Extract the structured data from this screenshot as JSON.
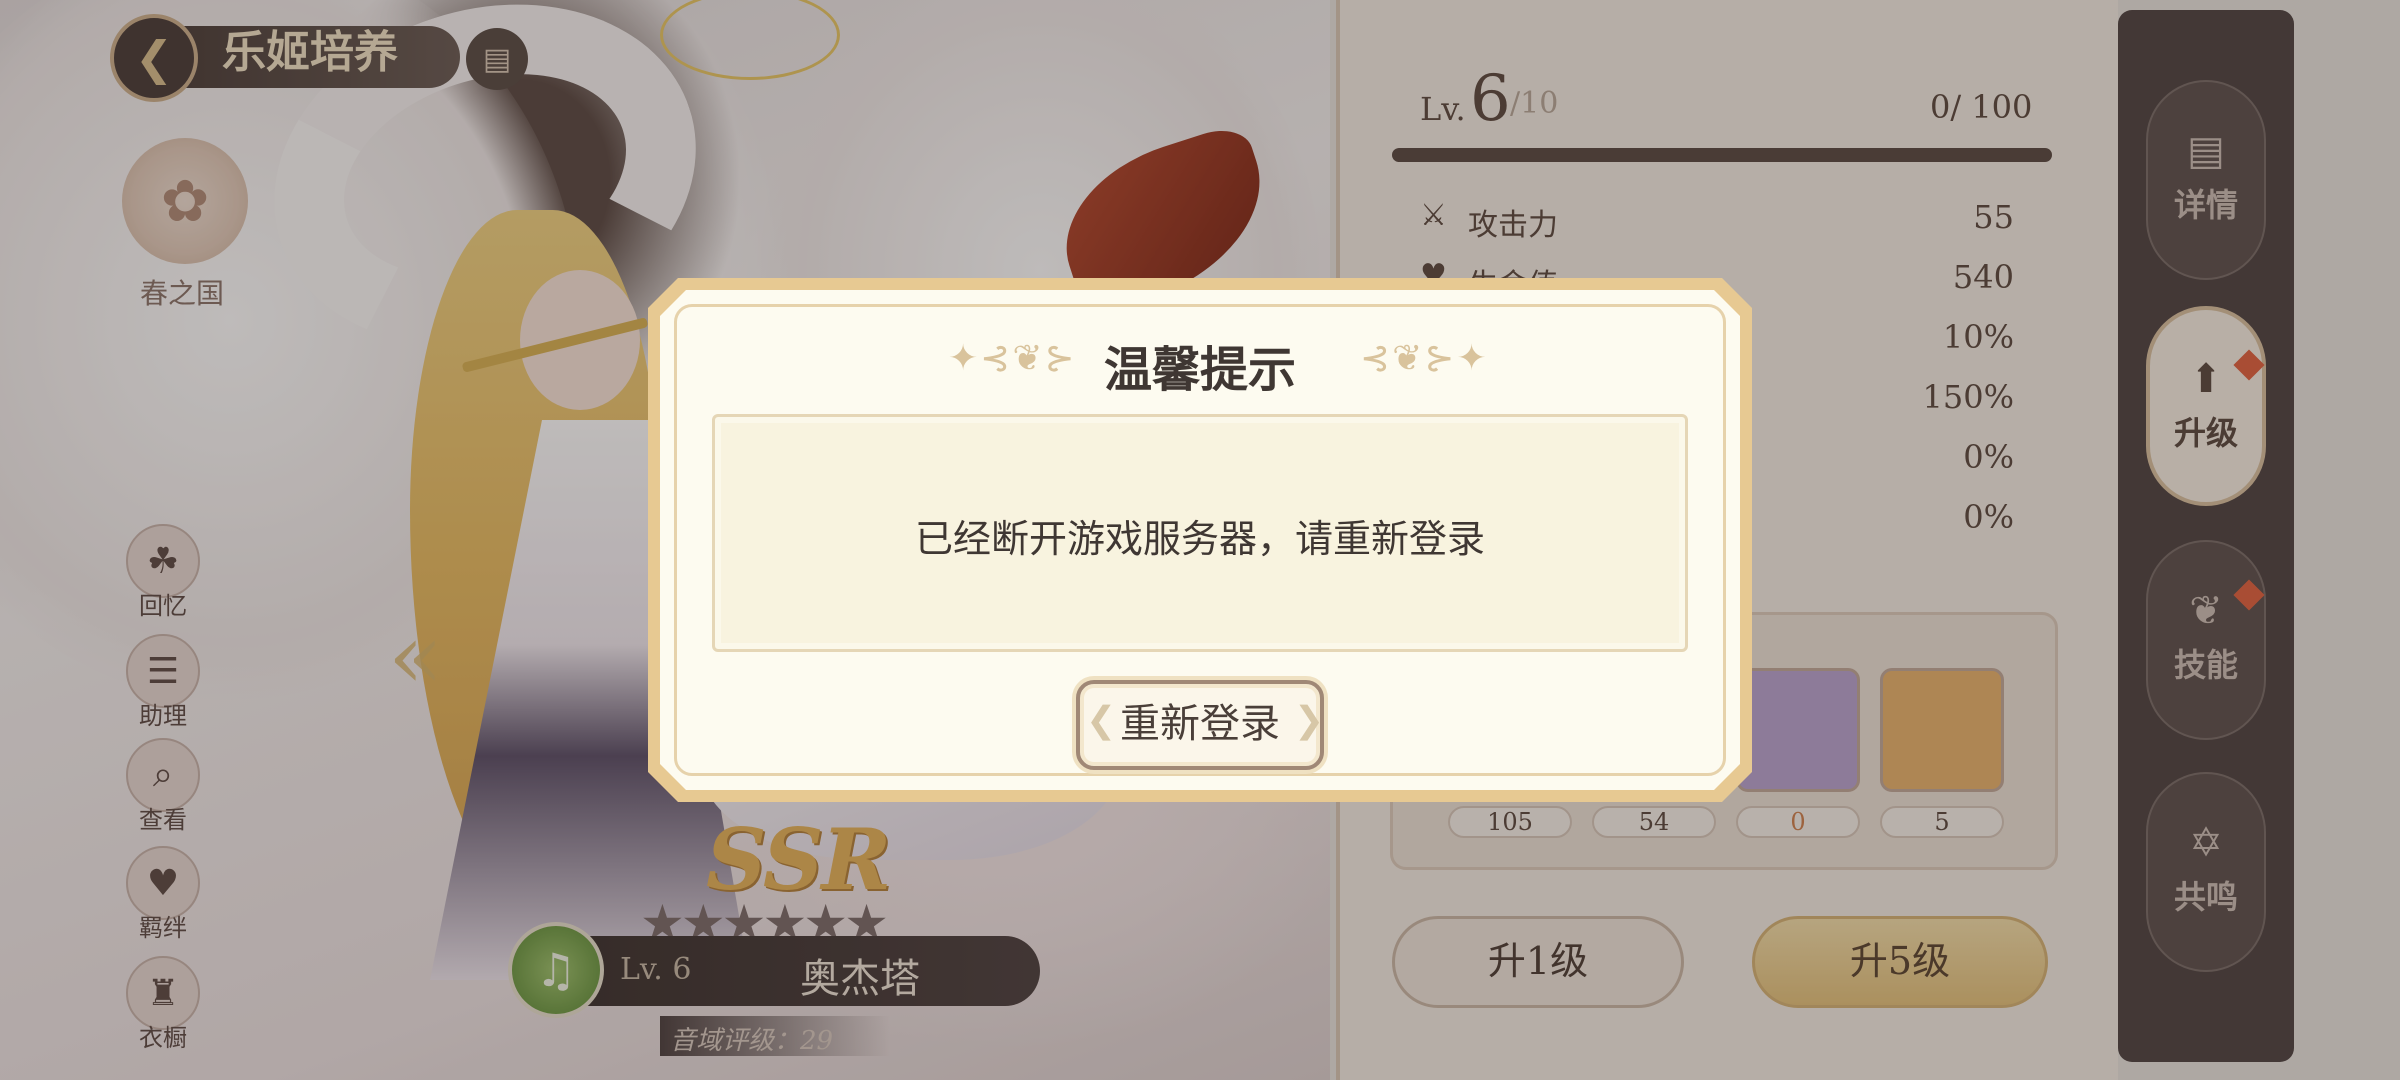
{
  "header": {
    "title": "乐姬培养",
    "back_icon": "arrow-back-icon",
    "doc_icon": "document-icon"
  },
  "nation": {
    "label": "春之国",
    "icon": "flower-emblem-icon"
  },
  "side_menu": [
    {
      "label": "回忆",
      "icon": "memory-icon"
    },
    {
      "label": "助理",
      "icon": "assistant-icon"
    },
    {
      "label": "查看",
      "icon": "magnifier-icon"
    },
    {
      "label": "羁绊",
      "icon": "heart-bond-icon"
    },
    {
      "label": "衣橱",
      "icon": "wardrobe-icon"
    }
  ],
  "character": {
    "rarity": "SSR",
    "stars": "★★★★★★",
    "level": "Lv. 6",
    "name": "奥杰塔",
    "rating": "音域评级：29"
  },
  "level_panel": {
    "lv_prefix": "Lv.",
    "lv_value": "6",
    "lv_max": "/10",
    "exp": "0/ 100"
  },
  "stats": [
    {
      "name": "攻击力",
      "value": "55",
      "icon": "sword-icon"
    },
    {
      "name": "生命值",
      "value": "540",
      "icon": "heart-icon"
    },
    {
      "name": "",
      "value": "10%",
      "icon": ""
    },
    {
      "name": "",
      "value": "150%",
      "icon": ""
    },
    {
      "name": "",
      "value": "0%",
      "icon": ""
    },
    {
      "name": "",
      "value": "0%",
      "icon": ""
    }
  ],
  "materials": [
    {
      "count": "105"
    },
    {
      "count": "54"
    },
    {
      "count": "0"
    },
    {
      "count": "5"
    }
  ],
  "buttons": {
    "up1": "升1级",
    "up5": "升5级"
  },
  "tabs": [
    {
      "label": "详情",
      "icon": "details-icon"
    },
    {
      "label": "升级",
      "icon": "upgrade-arrow-icon"
    },
    {
      "label": "技能",
      "icon": "skill-icon"
    },
    {
      "label": "共鸣",
      "icon": "resonance-icon"
    }
  ],
  "dialog": {
    "title": "温馨提示",
    "message": "已经断开游戏服务器，请重新登录",
    "button": "重新登录"
  },
  "colors": {
    "dialog_border": "#e7c992",
    "dialog_bg": "#fdfbf0",
    "accent_gold": "#e4c27c",
    "dark_panel": "#4f4442"
  }
}
